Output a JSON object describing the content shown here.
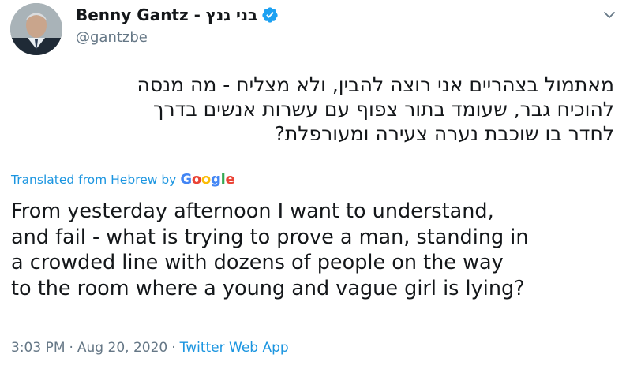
{
  "tweet": {
    "author": {
      "display_name": "Benny Gantz - בני גנץ",
      "handle": "@gantzbe",
      "avatar_icon": "profile-photo",
      "verified_icon": "verified-badge-icon"
    },
    "menu_icon": "chevron-down-icon",
    "hebrew_text": [
      "מאתמול בצהריים אני רוצה להבין, ולא מצליח - מה מנסה",
      "להוכיח גבר, שעומד בתור צפוף עם עשרות אנשים בדרך",
      "לחדר בו שוכבת נערה צעירה ומעורפלת?"
    ],
    "translation": {
      "label": "Translated from Hebrew by",
      "provider": "Google",
      "text": [
        "From yesterday afternoon I want to understand,",
        "and fail - what is trying to prove a man, standing in",
        "a crowded line with dozens of people on the way",
        "to the room where a young and vague girl is lying?"
      ]
    },
    "meta": {
      "time": "3:03 PM",
      "separator": "·",
      "date": "Aug 20, 2020",
      "source": "Twitter Web App"
    }
  },
  "colors": {
    "link_blue": "#1b95e0",
    "muted": "#657786",
    "text": "#14171a"
  }
}
